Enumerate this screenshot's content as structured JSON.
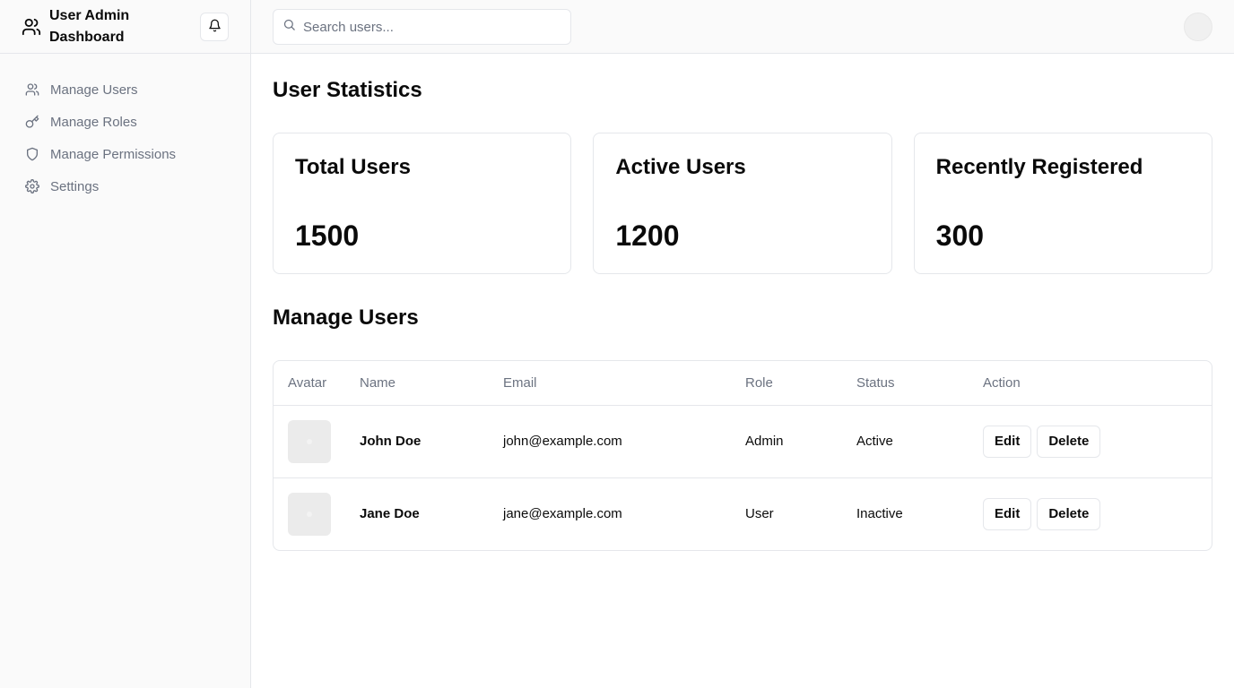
{
  "app": {
    "title": "User Admin Dashboard"
  },
  "sidebar": {
    "items": [
      {
        "label": "Manage Users",
        "icon": "users-icon"
      },
      {
        "label": "Manage Roles",
        "icon": "key-icon"
      },
      {
        "label": "Manage Permissions",
        "icon": "shield-icon"
      },
      {
        "label": "Settings",
        "icon": "gear-icon"
      }
    ]
  },
  "search": {
    "placeholder": "Search users..."
  },
  "stats": {
    "title": "User Statistics",
    "cards": [
      {
        "label": "Total Users",
        "value": "1500"
      },
      {
        "label": "Active Users",
        "value": "1200"
      },
      {
        "label": "Recently Registered",
        "value": "300"
      }
    ]
  },
  "users": {
    "title": "Manage Users",
    "columns": [
      "Avatar",
      "Name",
      "Email",
      "Role",
      "Status",
      "Action"
    ],
    "rows": [
      {
        "name": "John Doe",
        "email": "john@example.com",
        "role": "Admin",
        "status": "Active"
      },
      {
        "name": "Jane Doe",
        "email": "jane@example.com",
        "role": "User",
        "status": "Inactive"
      }
    ],
    "edit_label": "Edit",
    "delete_label": "Delete"
  }
}
